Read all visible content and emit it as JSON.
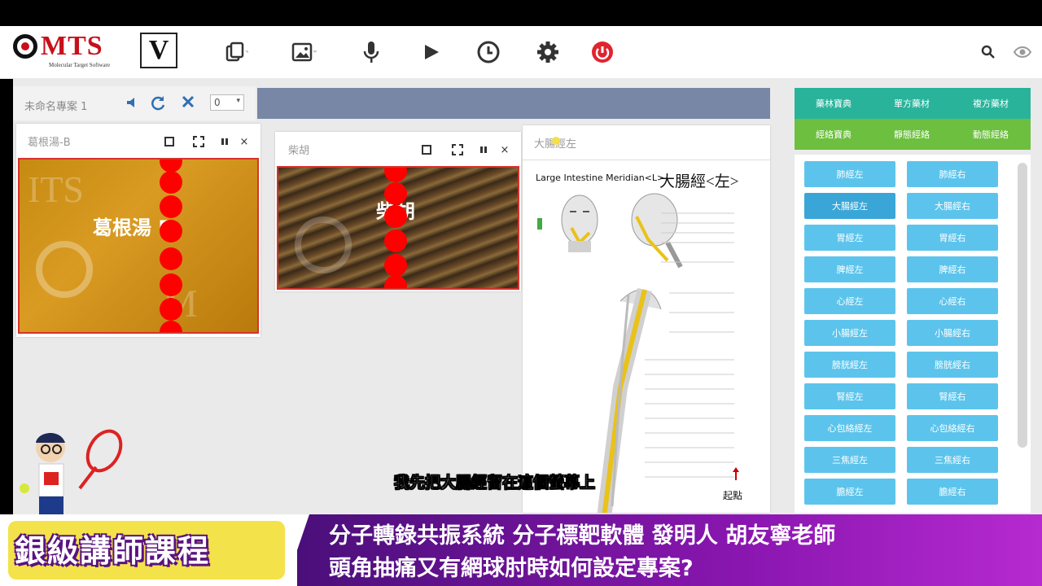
{
  "app": {
    "logo_text": "MTS",
    "logo_sub": "Molecular Target Software",
    "logo_badge": "V"
  },
  "toolbar": {
    "icons": [
      "copy-icon",
      "image-icon",
      "microphone-icon",
      "play-icon",
      "clock-icon",
      "gear-icon",
      "power-icon"
    ],
    "right_icons": [
      "search-icon",
      "eye-icon"
    ]
  },
  "project": {
    "name": "未命名專案 1",
    "select_value": "0"
  },
  "windows": [
    {
      "title": "葛根湯-B",
      "label": "葛根湯 B"
    },
    {
      "title": "柴胡",
      "label": "柴胡"
    },
    {
      "title": "大腸經左",
      "heading_en": "Large Intestine Meridian<L>",
      "heading_zh": "大腸經<左>",
      "start_label": "起點"
    }
  ],
  "categories": [
    "藥林寶典",
    "單方藥材",
    "複方藥材",
    "經絡寶典",
    "靜態經絡",
    "動態經絡"
  ],
  "meridians": [
    [
      "肺經左",
      "肺經右"
    ],
    [
      "大腸經左",
      "大腸經右"
    ],
    [
      "胃經左",
      "胃經右"
    ],
    [
      "脾經左",
      "脾經右"
    ],
    [
      "心經左",
      "心經右"
    ],
    [
      "小腸經左",
      "小腸經右"
    ],
    [
      "膀胱經左",
      "膀胱經右"
    ],
    [
      "腎經左",
      "腎經右"
    ],
    [
      "心包絡經左",
      "心包絡經右"
    ],
    [
      "三焦經左",
      "三焦經右"
    ],
    [
      "膽經左",
      "膽經右"
    ]
  ],
  "subtitle": "我先把大腸經留在這個螢幕上",
  "banner": {
    "badge": "銀級講師課程",
    "line1": "分子轉錄共振系統 分子標靶軟體 發明人 胡友寧老師",
    "line2": "頭角抽痛又有網球肘時如何設定專案?"
  },
  "colors": {
    "accent_red": "#c8101a",
    "meridian_button": "#5cc4ec",
    "category_teal": "#29b39b",
    "category_green": "#6cbf3f",
    "banner_purple": "#7a17a0"
  }
}
